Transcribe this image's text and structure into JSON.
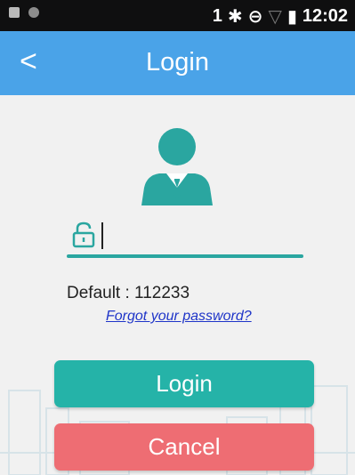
{
  "status_bar": {
    "signal_number": "1",
    "time": "12:02",
    "icons": [
      "image-icon",
      "circle-icon",
      "bluetooth-icon",
      "do-not-disturb-icon",
      "wifi-icon",
      "battery-icon"
    ]
  },
  "app_bar": {
    "back_label": "<",
    "title": "Login",
    "background": "#4aa3e8"
  },
  "form": {
    "password_value": "",
    "default_text": "Default : 112233",
    "forgot_link": "Forgot your password?",
    "accent_color": "#2aa6a0"
  },
  "buttons": {
    "login_label": "Login",
    "login_color": "#25b3a8",
    "cancel_label": "Cancel",
    "cancel_color": "#ee6d73"
  }
}
